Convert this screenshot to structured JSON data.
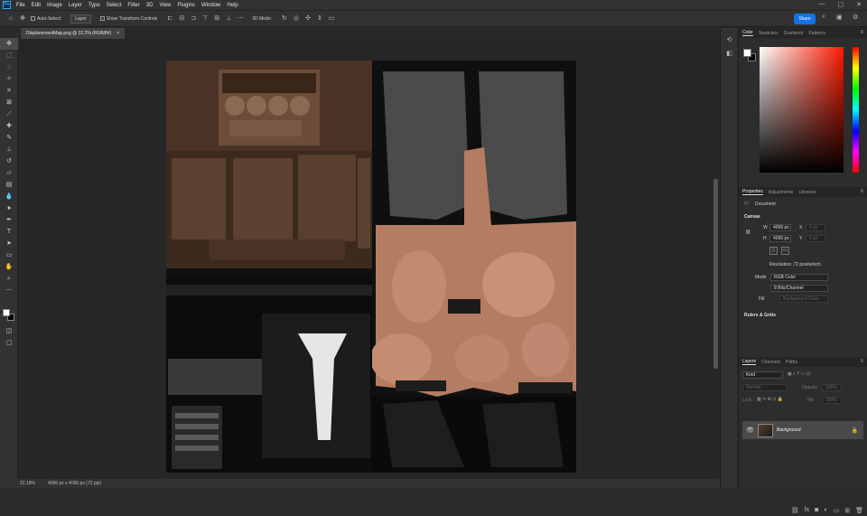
{
  "app": {
    "logo": "Ps"
  },
  "menu": [
    "File",
    "Edit",
    "Image",
    "Layer",
    "Type",
    "Select",
    "Filter",
    "3D",
    "View",
    "Plugins",
    "Window",
    "Help"
  ],
  "window_controls": {
    "minimize": "—",
    "maximize": "▢",
    "close": "✕"
  },
  "options": {
    "auto_select_label": "Auto-Select:",
    "target_value": "Layer",
    "transform_label": "Show Transform Controls",
    "mode_label": "3D Mode:",
    "share_label": "Share"
  },
  "document": {
    "tab_title": "DisplacementMap.png @ 22.2% (RGB/8#)",
    "close_glyph": "×"
  },
  "status": {
    "zoom": "22.18%",
    "info": "4096 px x 4096 px (72 ppi)"
  },
  "tools": [
    "move-icon",
    "marquee-icon",
    "lasso-icon",
    "magic-wand-icon",
    "crop-icon",
    "frame-icon",
    "eyedropper-icon",
    "healing-icon",
    "brush-icon",
    "stamp-icon",
    "history-brush-icon",
    "eraser-icon",
    "gradient-icon",
    "blur-icon",
    "dodge-icon",
    "pen-icon",
    "type-icon",
    "path-select-icon",
    "shape-icon",
    "hand-icon",
    "zoom-icon",
    "more-icon"
  ],
  "colors": {
    "fg": "#ffffff",
    "bg": "#000000",
    "accent": "#1473e6"
  },
  "panels": {
    "color_tabs": [
      "Color",
      "Swatches",
      "Gradients",
      "Patterns"
    ],
    "properties_tabs": [
      "Properties",
      "Adjustments",
      "Libraries"
    ],
    "properties": {
      "type": "Document",
      "canvas_title": "Canvas",
      "w_label": "W",
      "w_value": "4096 px",
      "h_label": "H",
      "h_value": "4096 px",
      "x_label": "X",
      "x_value": "0 px",
      "y_label": "Y",
      "y_value": "0 px",
      "resolution": "Resolution: 72 pixels/inch",
      "mode_label": "Mode",
      "mode_value": "RGB Color",
      "depth_value": "8 Bits/Channel",
      "fill_label": "Fill",
      "fill_value": "Background Color",
      "rulers_title": "Rulers & Grids"
    },
    "layers_tabs": [
      "Layers",
      "Channels",
      "Paths"
    ],
    "layers": {
      "search_placeholder": "Kind",
      "blend_mode": "Normal",
      "opacity_label": "Opacity:",
      "opacity_value": "100%",
      "lock_label": "Lock:",
      "fill_label": "Fill:",
      "fill_value": "100%",
      "items": [
        {
          "name": "Background",
          "locked": true,
          "visible": true
        }
      ]
    }
  }
}
